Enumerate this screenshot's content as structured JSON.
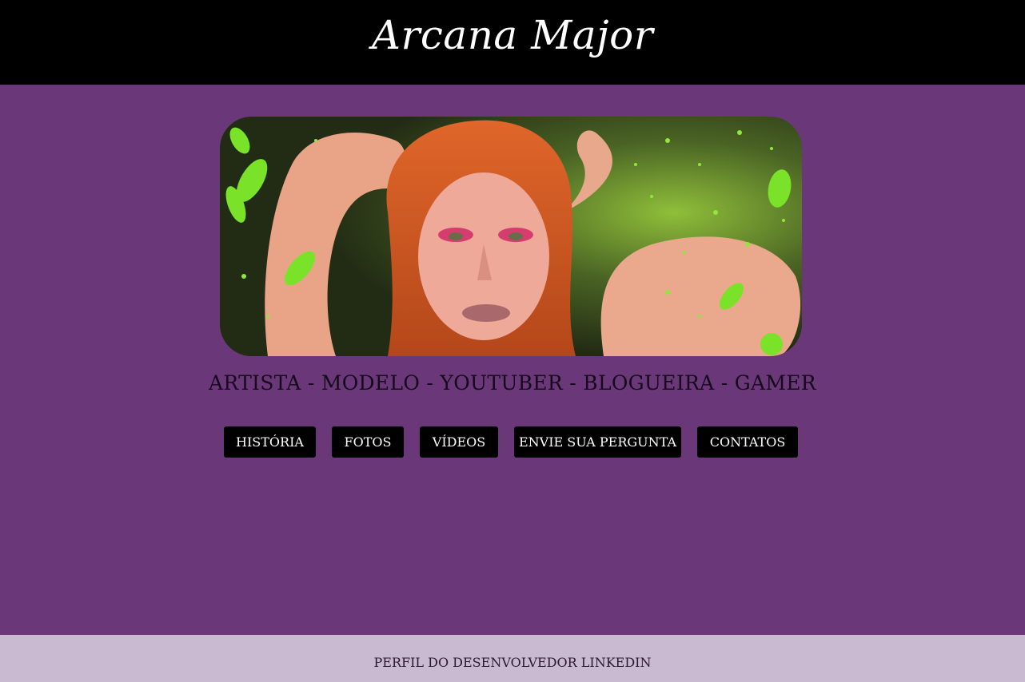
{
  "header": {
    "title": "Arcana Major"
  },
  "hero": {
    "image_alt": "portrait-photo"
  },
  "tagline": "ARTISTA - MODELO - YOUTUBER - BLOGUEIRA - GAMER",
  "nav": {
    "items": [
      {
        "label": "HISTÓRIA"
      },
      {
        "label": "FOTOS"
      },
      {
        "label": "VÍDEOS"
      },
      {
        "label": "ENVIE SUA PERGUNTA"
      },
      {
        "label": "CONTATOS"
      }
    ]
  },
  "footer": {
    "link_label": "PERFIL DO DESENVOLVEDOR LINKEDIN"
  },
  "colors": {
    "header_bg": "#000000",
    "page_bg": "#6a3879",
    "footer_bg": "#c9b9d1",
    "button_bg": "#000000",
    "button_text": "#ffffff"
  }
}
